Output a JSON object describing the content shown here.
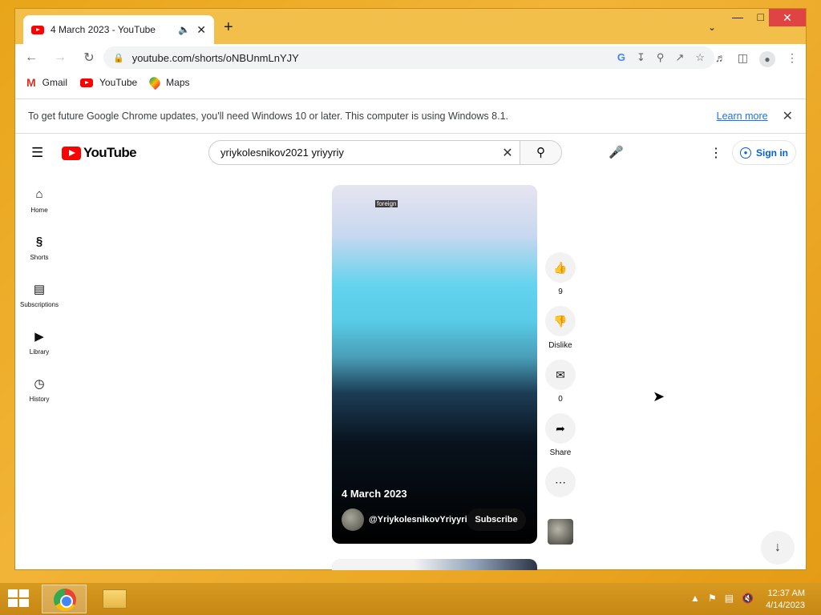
{
  "browser": {
    "tab_title": "4 March 2023 - YouTube",
    "tab_audio_icon": "speaker-icon",
    "url": "youtube.com/shorts/oNBUnmLnYJY",
    "bookmarks": [
      "Gmail",
      "YouTube",
      "Maps"
    ],
    "infobar_message": "To get future Google Chrome updates, you'll need Windows 10 or later. This computer is using Windows 8.1.",
    "infobar_link": "Learn more"
  },
  "youtube": {
    "brand": "YouTube",
    "search_query": "yriykolesnikov2021 yriyyriy",
    "sign_in": "Sign in",
    "guide": [
      "Home",
      "Shorts",
      "Subscriptions",
      "Library",
      "History"
    ],
    "short": {
      "overlay_tag": "foreign",
      "title": "4 March 2023",
      "channel": "@YriykolesnikovYriyyriy",
      "subscribe": "Subscribe"
    },
    "actions": {
      "likes": "9",
      "dislike": "Dislike",
      "comments": "0",
      "share": "Share"
    }
  },
  "taskbar": {
    "time": "12:37 AM",
    "date": "4/14/2023"
  },
  "colors": {
    "accent": "#065fd4",
    "youtube_red": "#ff0000",
    "taskbar": "#d79a21"
  }
}
